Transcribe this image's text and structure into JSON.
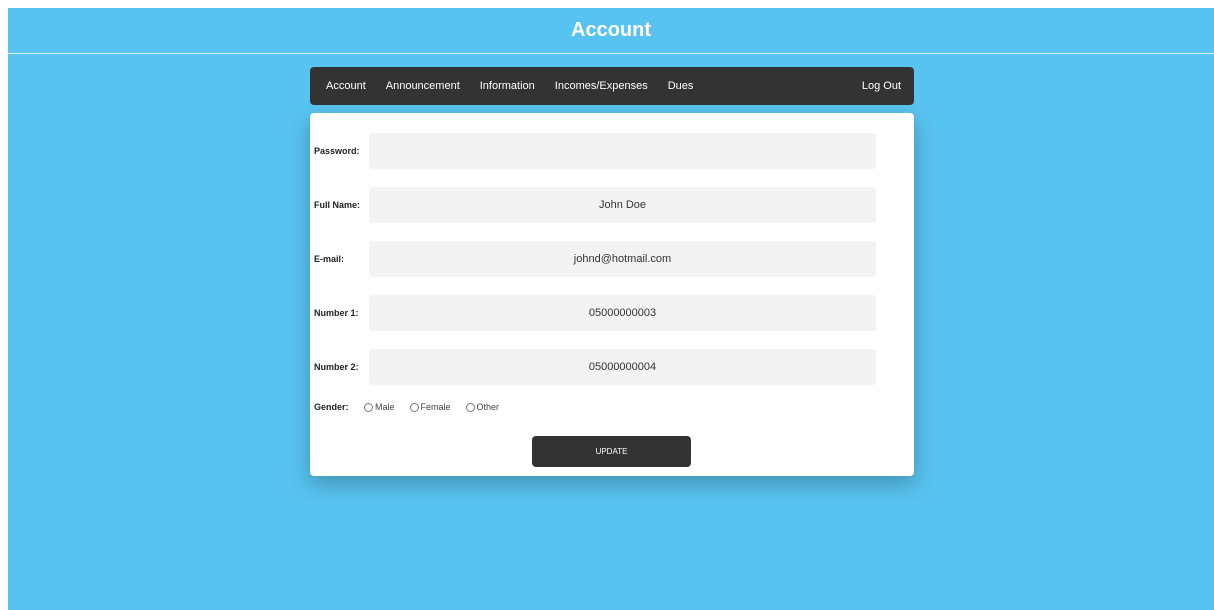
{
  "header": {
    "title": "Account"
  },
  "nav": {
    "items": [
      {
        "label": "Account"
      },
      {
        "label": "Announcement"
      },
      {
        "label": "Information"
      },
      {
        "label": "Incomes/Expenses"
      },
      {
        "label": "Dues"
      }
    ],
    "logout_label": "Log Out"
  },
  "form": {
    "password": {
      "label": "Password:",
      "value": ""
    },
    "full_name": {
      "label": "Full Name:",
      "value": "John Doe"
    },
    "email": {
      "label": "E-mail:",
      "value": "johnd@hotmail.com"
    },
    "number1": {
      "label": "Number 1:",
      "value": "05000000003"
    },
    "number2": {
      "label": "Number 2:",
      "value": "05000000004"
    },
    "gender": {
      "label": "Gender:",
      "options": [
        {
          "label": "Male"
        },
        {
          "label": "Female"
        },
        {
          "label": "Other"
        }
      ]
    },
    "update_label": "UPDATE"
  },
  "colors": {
    "background": "#58c3f0",
    "navbar": "#333333",
    "button": "#333333",
    "field": "#f3f3f3"
  }
}
